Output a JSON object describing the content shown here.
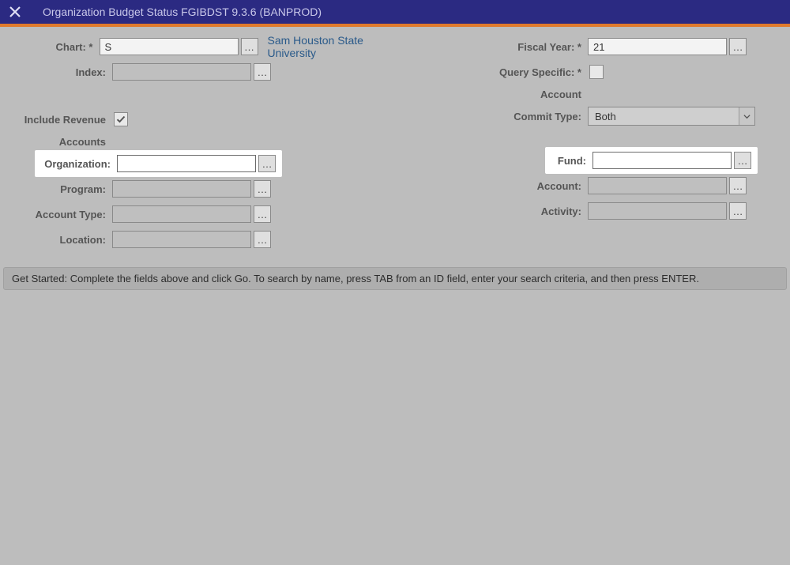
{
  "title": "Organization Budget Status FGIBDST 9.3.6 (BANPROD)",
  "labels": {
    "chart": "Chart: *",
    "index": "Index:",
    "include_revenue": "Include Revenue",
    "accounts": "Accounts",
    "organization": "Organization:",
    "program": "Program:",
    "account_type": "Account Type:",
    "location": "Location:",
    "fiscal_year": "Fiscal Year: *",
    "query_specific": "Query Specific: *",
    "account_sub": "Account",
    "commit_type": "Commit Type:",
    "fund": "Fund:",
    "account": "Account:",
    "activity": "Activity:"
  },
  "values": {
    "chart": "S",
    "chart_desc": "Sam Houston State University",
    "index": "",
    "organization": "",
    "program": "",
    "account_type": "",
    "location": "",
    "fiscal_year": "21",
    "commit_type": "Both",
    "fund": "",
    "account": "",
    "activity": ""
  },
  "checks": {
    "include_revenue": true,
    "query_specific": false
  },
  "hint": "Get Started: Complete the fields above and click Go. To search by name, press TAB from an ID field, enter your search criteria, and then press ENTER."
}
